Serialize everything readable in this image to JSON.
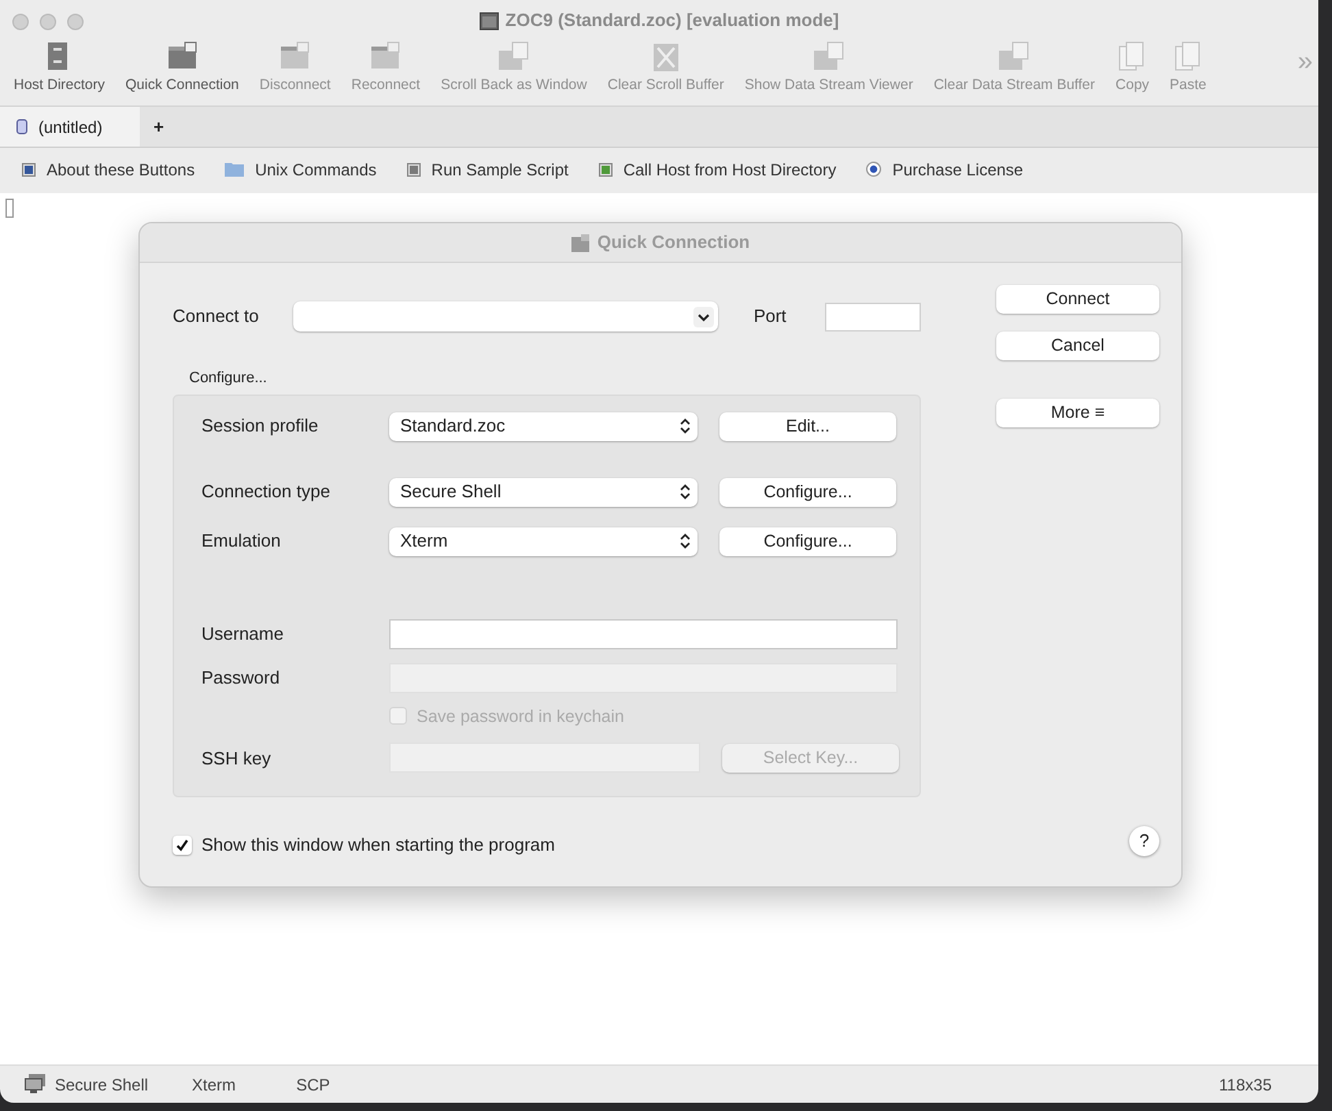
{
  "window": {
    "title": "ZOC9 (Standard.zoc) [evaluation mode]"
  },
  "toolbar": [
    {
      "label": "Host Directory",
      "kind": "directory",
      "disabled": false
    },
    {
      "label": "Quick Connection",
      "kind": "terminal",
      "disabled": false
    },
    {
      "label": "Disconnect",
      "kind": "terminal",
      "disabled": true
    },
    {
      "label": "Reconnect",
      "kind": "terminal",
      "disabled": true
    },
    {
      "label": "Scroll Back as Window",
      "kind": "window",
      "disabled": true
    },
    {
      "label": "Clear Scroll Buffer",
      "kind": "clear",
      "disabled": true
    },
    {
      "label": "Show Data Stream Viewer",
      "kind": "window",
      "disabled": true
    },
    {
      "label": "Clear Data Stream Buffer",
      "kind": "window",
      "disabled": true
    },
    {
      "label": "Copy",
      "kind": "doc",
      "disabled": true
    },
    {
      "label": "Paste",
      "kind": "doc",
      "disabled": true
    }
  ],
  "toolbar_more": "»",
  "tabs": [
    {
      "label": "(untitled)",
      "selected": true
    }
  ],
  "new_tab": "+",
  "button_bar": [
    {
      "label": "About these Buttons",
      "kind": "square",
      "color": "#34569a"
    },
    {
      "label": "Unix Commands",
      "kind": "folder",
      "color": "#8fb2dd"
    },
    {
      "label": "Run Sample Script",
      "kind": "square",
      "color": "#7a7a7a"
    },
    {
      "label": "Call Host from Host Directory",
      "kind": "square",
      "color": "#4f9a3a"
    },
    {
      "label": "Purchase License",
      "kind": "radio",
      "color": "#2f55b5"
    }
  ],
  "dialog": {
    "title": "Quick Connection",
    "connect_to": {
      "label": "Connect to"
    },
    "port": {
      "label": "Port"
    },
    "buttons": [
      "Connect",
      "Cancel",
      "More ≡"
    ],
    "configure_label": "Configure...",
    "popups": [
      {
        "label": "Session profile",
        "value": "Standard.zoc",
        "button": "Edit..."
      },
      {
        "label": "Connection type",
        "value": "Secure Shell",
        "button": "Configure..."
      },
      {
        "label": "Emulation",
        "value": "Xterm",
        "button": "Configure..."
      }
    ],
    "username": {
      "label": "Username",
      "disabled": false
    },
    "password": {
      "label": "Password",
      "disabled": true
    },
    "save_password": {
      "label": "Save password in keychain",
      "checked": false,
      "disabled": true
    },
    "ssh_key": {
      "label": "SSH key",
      "disabled": true,
      "button": "Select Key..."
    },
    "show_on_start": {
      "label": "Show this window when starting the program",
      "checked": true
    },
    "help": "?"
  },
  "status_bar": {
    "items": [
      "Secure Shell",
      "Xterm",
      "SCP"
    ],
    "size": "118x35"
  }
}
